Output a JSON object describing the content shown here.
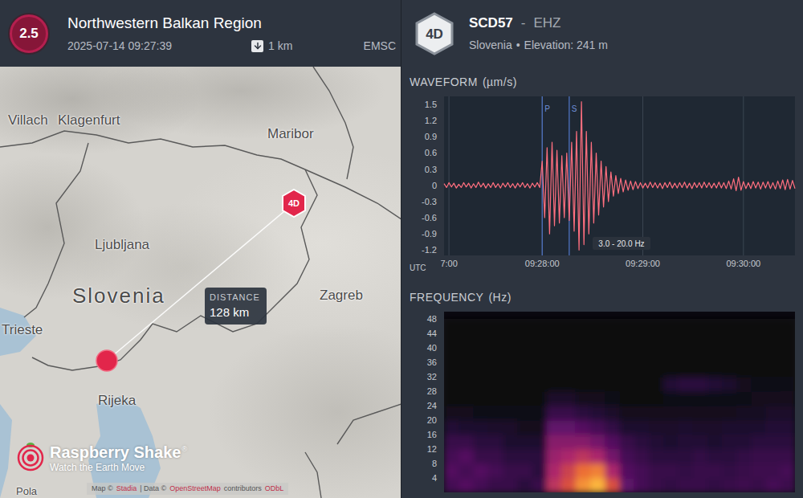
{
  "event": {
    "magnitude": "2.5",
    "region": "Northwestern Balkan Region",
    "time": "2025-07-14 09:27:39",
    "depth": "1 km",
    "agency": "EMSC"
  },
  "map": {
    "labels": [
      {
        "text": "Villach",
        "kind": "city"
      },
      {
        "text": "Klagenfurt",
        "kind": "city"
      },
      {
        "text": "Maribor",
        "kind": "city"
      },
      {
        "text": "Ljubljana",
        "kind": "city"
      },
      {
        "text": "Slovenia",
        "kind": "country"
      },
      {
        "text": "Zagreb",
        "kind": "city"
      },
      {
        "text": "Trieste",
        "kind": "city"
      },
      {
        "text": "Rijeka",
        "kind": "city"
      },
      {
        "text": "Pola",
        "kind": "small"
      }
    ],
    "station_pin": "4D",
    "distance": {
      "label": "DISTANCE",
      "value": "128 km"
    },
    "logo": {
      "name": "Raspberry Shake",
      "mark": "®",
      "tagline": "Watch the Earth Move"
    },
    "attribution": [
      {
        "text": "Map ©",
        "link": false
      },
      {
        "text": "Stadia",
        "link": true
      },
      {
        "text": "| Data ©",
        "link": false
      },
      {
        "text": "OpenStreetMap",
        "link": true
      },
      {
        "text": "contributors",
        "link": false
      },
      {
        "text": "ODbL",
        "link": true
      }
    ]
  },
  "station": {
    "network": "4D",
    "code": "SCD57",
    "separator": "-",
    "channel": "EHZ",
    "country": "Slovenia",
    "bullet": "•",
    "elevation": "Elevation: 241 m"
  },
  "waveform": {
    "title": "WAVEFORM",
    "unit": "(µm/s)",
    "y_ticks": [
      "1.5",
      "1.2",
      "0.9",
      "0.6",
      "0.3",
      "0",
      "-0.3",
      "-0.6",
      "-0.9",
      "-1.2"
    ],
    "x_axis_label": "UTC",
    "x_ticks": [
      {
        "label": "7:00",
        "at": 2
      },
      {
        "label": "09:28:00",
        "at": 40
      },
      {
        "label": "09:29:00",
        "at": 81
      },
      {
        "label": "09:30:00",
        "at": 122
      }
    ],
    "phases": [
      {
        "label": "P",
        "at": 40
      },
      {
        "label": "S",
        "at": 51
      }
    ],
    "filter": "3.0 - 20.0 Hz",
    "values": [
      0.03,
      -0.04,
      0.05,
      -0.03,
      0.04,
      -0.05,
      0.02,
      -0.04,
      0.05,
      -0.03,
      0.04,
      -0.05,
      0.03,
      -0.04,
      0.06,
      -0.03,
      0.04,
      -0.05,
      0.03,
      -0.04,
      0.05,
      -0.04,
      0.03,
      -0.05,
      0.04,
      -0.03,
      0.05,
      -0.04,
      0.03,
      -0.05,
      0.04,
      -0.03,
      0.05,
      -0.04,
      0.03,
      -0.05,
      0.04,
      -0.03,
      0.05,
      -0.04,
      0.45,
      -0.6,
      0.7,
      -0.9,
      0.8,
      -0.75,
      0.65,
      -0.7,
      0.55,
      -0.6,
      0.6,
      -0.65,
      0.8,
      -0.85,
      1.0,
      -1.2,
      1.55,
      -1.1,
      1.0,
      -0.9,
      0.8,
      -0.7,
      0.6,
      -0.55,
      0.45,
      -0.4,
      0.35,
      -0.3,
      0.25,
      -0.2,
      0.18,
      -0.15,
      0.13,
      -0.12,
      0.1,
      -0.09,
      0.08,
      -0.08,
      0.07,
      -0.06,
      0.05,
      -0.05,
      0.04,
      -0.05,
      0.06,
      -0.04,
      0.05,
      -0.05,
      0.04,
      -0.06,
      0.05,
      -0.04,
      0.06,
      -0.05,
      0.04,
      -0.05,
      0.05,
      -0.04,
      0.06,
      -0.05,
      0.04,
      -0.06,
      0.05,
      -0.04,
      0.05,
      -0.05,
      0.06,
      -0.04,
      0.05,
      -0.05,
      0.04,
      -0.05,
      0.06,
      -0.05,
      0.05,
      -0.06,
      0.08,
      -0.07,
      0.12,
      -0.1,
      0.15,
      -0.09,
      0.07,
      -0.06,
      0.05,
      -0.06,
      0.07,
      -0.05,
      0.06,
      -0.07,
      0.06,
      -0.05,
      0.07,
      -0.06,
      0.05,
      -0.07,
      0.08,
      -0.06,
      0.1,
      -0.08,
      0.11,
      -0.07,
      0.09,
      -0.06
    ]
  },
  "spectrogram": {
    "title": "FREQUENCY",
    "unit": "(Hz)",
    "y_ticks": [
      "48",
      "44",
      "40",
      "36",
      "32",
      "28",
      "24",
      "20",
      "16",
      "12",
      "8",
      "4"
    ],
    "power": [
      [
        0.25,
        0.3,
        0.25,
        0.2,
        0.12,
        0.05,
        0,
        0,
        0,
        0,
        0,
        0
      ],
      [
        0.3,
        0.25,
        0.3,
        0.2,
        0.1,
        0.05,
        0,
        0,
        0,
        0,
        0,
        0
      ],
      [
        0.25,
        0.3,
        0.2,
        0.15,
        0.1,
        0.03,
        0,
        0,
        0,
        0,
        0,
        0
      ],
      [
        0.2,
        0.25,
        0.2,
        0.15,
        0.08,
        0.03,
        0,
        0,
        0,
        0,
        0,
        0
      ],
      [
        0.2,
        0.2,
        0.15,
        0.1,
        0.08,
        0.02,
        0,
        0,
        0,
        0,
        0,
        0
      ],
      [
        0.15,
        0.2,
        0.15,
        0.1,
        0.05,
        0.02,
        0,
        0,
        0,
        0,
        0,
        0
      ],
      [
        0.2,
        0.15,
        0.15,
        0.1,
        0.05,
        0.02,
        0,
        0,
        0,
        0,
        0,
        0
      ],
      [
        0.6,
        0.55,
        0.5,
        0.45,
        0.35,
        0.2,
        0.08,
        0,
        0,
        0,
        0,
        0
      ],
      [
        0.7,
        0.65,
        0.55,
        0.45,
        0.35,
        0.2,
        0.08,
        0,
        0,
        0,
        0,
        0
      ],
      [
        0.9,
        0.8,
        0.6,
        0.45,
        0.3,
        0.15,
        0.05,
        0,
        0,
        0,
        0,
        0
      ],
      [
        1.0,
        0.85,
        0.55,
        0.4,
        0.25,
        0.12,
        0.04,
        0,
        0,
        0,
        0,
        0
      ],
      [
        0.7,
        0.55,
        0.4,
        0.3,
        0.18,
        0.08,
        0.02,
        0,
        0,
        0,
        0,
        0
      ],
      [
        0.35,
        0.3,
        0.25,
        0.2,
        0.1,
        0.05,
        0,
        0,
        0,
        0,
        0,
        0
      ],
      [
        0.25,
        0.25,
        0.2,
        0.15,
        0.1,
        0.05,
        0,
        0,
        0,
        0,
        0,
        0
      ],
      [
        0.2,
        0.2,
        0.15,
        0.12,
        0.08,
        0.04,
        0,
        0,
        0,
        0,
        0,
        0
      ],
      [
        0.18,
        0.2,
        0.15,
        0.1,
        0.08,
        0.04,
        0.02,
        0.12,
        0,
        0,
        0,
        0
      ],
      [
        0.2,
        0.18,
        0.15,
        0.12,
        0.1,
        0.05,
        0.02,
        0.15,
        0,
        0,
        0,
        0
      ],
      [
        0.2,
        0.2,
        0.18,
        0.12,
        0.08,
        0.04,
        0.02,
        0.15,
        0,
        0,
        0,
        0
      ],
      [
        0.18,
        0.2,
        0.15,
        0.1,
        0.08,
        0.05,
        0.02,
        0.12,
        0,
        0,
        0,
        0
      ],
      [
        0.2,
        0.18,
        0.15,
        0.12,
        0.1,
        0.05,
        0.02,
        0.1,
        0,
        0,
        0,
        0
      ],
      [
        0.22,
        0.2,
        0.18,
        0.12,
        0.1,
        0.06,
        0.03,
        0.05,
        0,
        0,
        0,
        0
      ],
      [
        0.2,
        0.22,
        0.2,
        0.15,
        0.1,
        0.06,
        0.04,
        0.03,
        0,
        0,
        0,
        0
      ],
      [
        0.25,
        0.22,
        0.2,
        0.15,
        0.12,
        0.08,
        0.04,
        0.03,
        0,
        0,
        0,
        0
      ],
      [
        0.22,
        0.25,
        0.2,
        0.15,
        0.12,
        0.08,
        0.05,
        0.03,
        0,
        0,
        0,
        0
      ]
    ]
  }
}
